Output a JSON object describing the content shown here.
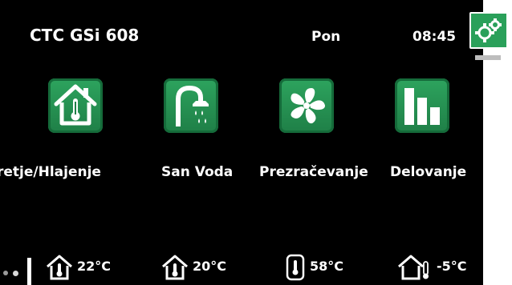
{
  "header": {
    "title": "CTC GSi 608",
    "day": "Pon",
    "time": "08:45"
  },
  "settings": {
    "icon": "gears-icon"
  },
  "tiles": [
    {
      "label": "retje/Hlajenje",
      "icon": "house-thermometer-icon"
    },
    {
      "label": "San Voda",
      "icon": "shower-icon"
    },
    {
      "label": "Prezračevanje",
      "icon": "fan-icon"
    },
    {
      "label": "Delovanje",
      "icon": "bar-chart-icon"
    }
  ],
  "status": [
    {
      "value": "22°C",
      "icon": "house-thermometer-icon"
    },
    {
      "value": "20°C",
      "icon": "house-thermometer-icon"
    },
    {
      "value": "58°C",
      "icon": "tank-thermometer-icon"
    },
    {
      "value": "-5°C",
      "icon": "outdoor-thermometer-icon"
    }
  ],
  "colors": {
    "background": "#000000",
    "accent": "#2aa05a",
    "text": "#ffffff"
  }
}
